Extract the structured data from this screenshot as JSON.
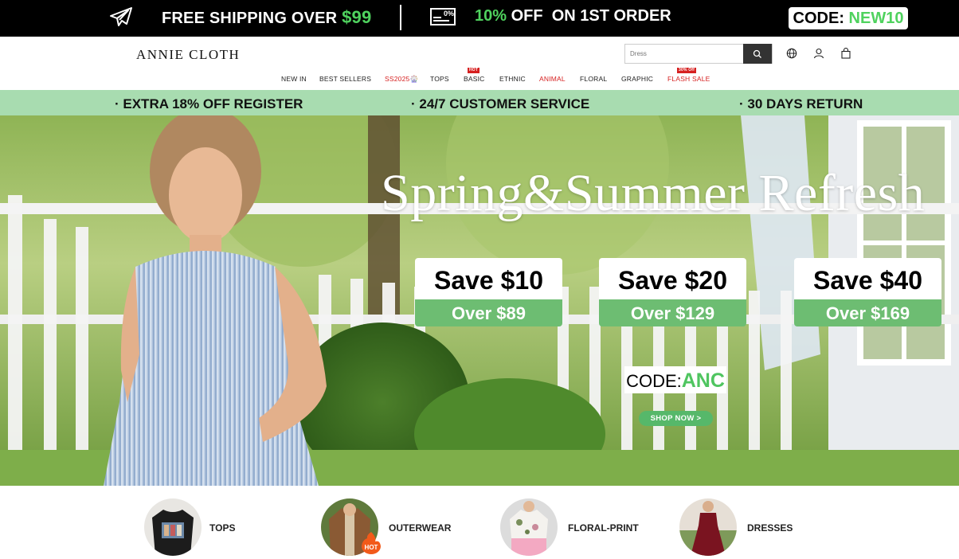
{
  "topbar": {
    "shipping_text": "FREE SHIPPING OVER ",
    "shipping_amount": "$99",
    "discount_pct": "10%",
    "discount_text": " OFF",
    "discount_suffix": "ON 1ST ORDER",
    "code_label": "CODE: ",
    "code_value": "NEW10",
    "tag_text": "0%"
  },
  "header": {
    "logo": "ANNIE CLOTH",
    "search_placeholder": "Dress"
  },
  "nav": {
    "items": [
      {
        "label": "NEW IN"
      },
      {
        "label": "BEST SELLERS"
      },
      {
        "label": "SS2025🎡"
      },
      {
        "label": "TOPS"
      },
      {
        "label": "BASIC",
        "badge": "HOT"
      },
      {
        "label": "ETHNIC"
      },
      {
        "label": "ANIMAL"
      },
      {
        "label": "FLORAL"
      },
      {
        "label": "GRAPHIC"
      },
      {
        "label": "FLASH SALE",
        "badge": "30% Off"
      }
    ]
  },
  "strip": {
    "items": [
      "· EXTRA 18% OFF   REGISTER",
      "· 24/7 CUSTOMER SERVICE",
      "· 30 DAYS RETURN"
    ]
  },
  "hero": {
    "title": "Spring&Summer Refresh",
    "cards": [
      {
        "save": "Save $10",
        "over": "Over $89"
      },
      {
        "save": "Save $20",
        "over": "Over $129"
      },
      {
        "save": "Save $40",
        "over": "Over $169"
      }
    ],
    "code_label": "CODE:",
    "code_value": "ANC",
    "cta": "SHOP NOW  >"
  },
  "categories": [
    {
      "label": "TOPS"
    },
    {
      "label": "OUTERWEAR",
      "badge": "HOT"
    },
    {
      "label": "FLORAL-PRINT"
    },
    {
      "label": "DRESSES"
    }
  ],
  "colors": {
    "accent_green": "#4fd25e",
    "strip_green": "#a8dcb0",
    "card_green": "#6dbd72",
    "sale_red": "#d62020"
  }
}
